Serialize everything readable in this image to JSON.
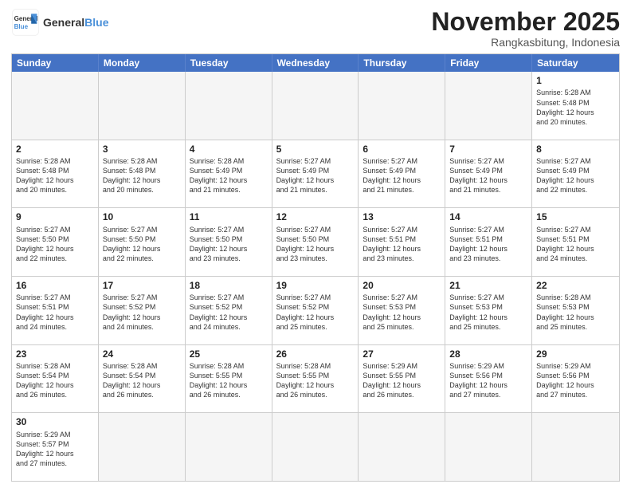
{
  "logo": {
    "general": "General",
    "blue": "Blue"
  },
  "title": "November 2025",
  "subtitle": "Rangkasbitung, Indonesia",
  "days": [
    "Sunday",
    "Monday",
    "Tuesday",
    "Wednesday",
    "Thursday",
    "Friday",
    "Saturday"
  ],
  "weeks": [
    [
      {
        "day": "",
        "info": "",
        "empty": true
      },
      {
        "day": "",
        "info": "",
        "empty": true
      },
      {
        "day": "",
        "info": "",
        "empty": true
      },
      {
        "day": "",
        "info": "",
        "empty": true
      },
      {
        "day": "",
        "info": "",
        "empty": true
      },
      {
        "day": "",
        "info": "",
        "empty": true
      },
      {
        "day": "1",
        "info": "Sunrise: 5:28 AM\nSunset: 5:48 PM\nDaylight: 12 hours\nand 20 minutes."
      }
    ],
    [
      {
        "day": "2",
        "info": "Sunrise: 5:28 AM\nSunset: 5:48 PM\nDaylight: 12 hours\nand 20 minutes."
      },
      {
        "day": "3",
        "info": "Sunrise: 5:28 AM\nSunset: 5:48 PM\nDaylight: 12 hours\nand 20 minutes."
      },
      {
        "day": "4",
        "info": "Sunrise: 5:28 AM\nSunset: 5:49 PM\nDaylight: 12 hours\nand 21 minutes."
      },
      {
        "day": "5",
        "info": "Sunrise: 5:27 AM\nSunset: 5:49 PM\nDaylight: 12 hours\nand 21 minutes."
      },
      {
        "day": "6",
        "info": "Sunrise: 5:27 AM\nSunset: 5:49 PM\nDaylight: 12 hours\nand 21 minutes."
      },
      {
        "day": "7",
        "info": "Sunrise: 5:27 AM\nSunset: 5:49 PM\nDaylight: 12 hours\nand 21 minutes."
      },
      {
        "day": "8",
        "info": "Sunrise: 5:27 AM\nSunset: 5:49 PM\nDaylight: 12 hours\nand 22 minutes."
      }
    ],
    [
      {
        "day": "9",
        "info": "Sunrise: 5:27 AM\nSunset: 5:50 PM\nDaylight: 12 hours\nand 22 minutes."
      },
      {
        "day": "10",
        "info": "Sunrise: 5:27 AM\nSunset: 5:50 PM\nDaylight: 12 hours\nand 22 minutes."
      },
      {
        "day": "11",
        "info": "Sunrise: 5:27 AM\nSunset: 5:50 PM\nDaylight: 12 hours\nand 23 minutes."
      },
      {
        "day": "12",
        "info": "Sunrise: 5:27 AM\nSunset: 5:50 PM\nDaylight: 12 hours\nand 23 minutes."
      },
      {
        "day": "13",
        "info": "Sunrise: 5:27 AM\nSunset: 5:51 PM\nDaylight: 12 hours\nand 23 minutes."
      },
      {
        "day": "14",
        "info": "Sunrise: 5:27 AM\nSunset: 5:51 PM\nDaylight: 12 hours\nand 23 minutes."
      },
      {
        "day": "15",
        "info": "Sunrise: 5:27 AM\nSunset: 5:51 PM\nDaylight: 12 hours\nand 24 minutes."
      }
    ],
    [
      {
        "day": "16",
        "info": "Sunrise: 5:27 AM\nSunset: 5:51 PM\nDaylight: 12 hours\nand 24 minutes."
      },
      {
        "day": "17",
        "info": "Sunrise: 5:27 AM\nSunset: 5:52 PM\nDaylight: 12 hours\nand 24 minutes."
      },
      {
        "day": "18",
        "info": "Sunrise: 5:27 AM\nSunset: 5:52 PM\nDaylight: 12 hours\nand 24 minutes."
      },
      {
        "day": "19",
        "info": "Sunrise: 5:27 AM\nSunset: 5:52 PM\nDaylight: 12 hours\nand 25 minutes."
      },
      {
        "day": "20",
        "info": "Sunrise: 5:27 AM\nSunset: 5:53 PM\nDaylight: 12 hours\nand 25 minutes."
      },
      {
        "day": "21",
        "info": "Sunrise: 5:27 AM\nSunset: 5:53 PM\nDaylight: 12 hours\nand 25 minutes."
      },
      {
        "day": "22",
        "info": "Sunrise: 5:28 AM\nSunset: 5:53 PM\nDaylight: 12 hours\nand 25 minutes."
      }
    ],
    [
      {
        "day": "23",
        "info": "Sunrise: 5:28 AM\nSunset: 5:54 PM\nDaylight: 12 hours\nand 26 minutes."
      },
      {
        "day": "24",
        "info": "Sunrise: 5:28 AM\nSunset: 5:54 PM\nDaylight: 12 hours\nand 26 minutes."
      },
      {
        "day": "25",
        "info": "Sunrise: 5:28 AM\nSunset: 5:55 PM\nDaylight: 12 hours\nand 26 minutes."
      },
      {
        "day": "26",
        "info": "Sunrise: 5:28 AM\nSunset: 5:55 PM\nDaylight: 12 hours\nand 26 minutes."
      },
      {
        "day": "27",
        "info": "Sunrise: 5:29 AM\nSunset: 5:55 PM\nDaylight: 12 hours\nand 26 minutes."
      },
      {
        "day": "28",
        "info": "Sunrise: 5:29 AM\nSunset: 5:56 PM\nDaylight: 12 hours\nand 27 minutes."
      },
      {
        "day": "29",
        "info": "Sunrise: 5:29 AM\nSunset: 5:56 PM\nDaylight: 12 hours\nand 27 minutes."
      }
    ],
    [
      {
        "day": "30",
        "info": "Sunrise: 5:29 AM\nSunset: 5:57 PM\nDaylight: 12 hours\nand 27 minutes."
      },
      {
        "day": "",
        "info": "",
        "empty": true
      },
      {
        "day": "",
        "info": "",
        "empty": true
      },
      {
        "day": "",
        "info": "",
        "empty": true
      },
      {
        "day": "",
        "info": "",
        "empty": true
      },
      {
        "day": "",
        "info": "",
        "empty": true
      },
      {
        "day": "",
        "info": "",
        "empty": true
      }
    ]
  ]
}
